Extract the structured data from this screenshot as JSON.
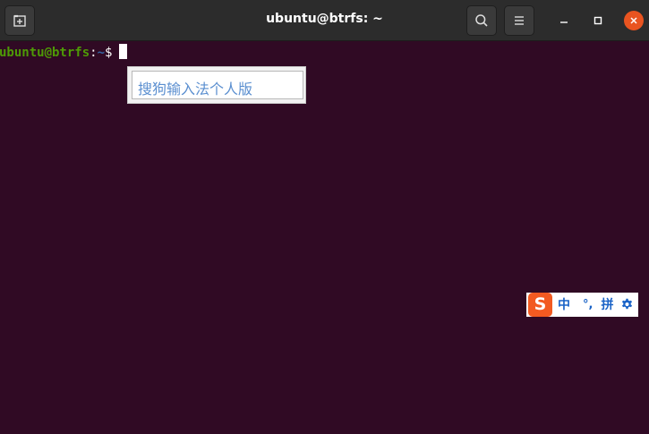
{
  "window": {
    "title": "ubuntu@btrfs: ~",
    "buttons": {
      "new_tab_icon": "new-tab-icon",
      "search_icon": "search-icon",
      "menu_icon": "hamburger-menu-icon",
      "minimize_icon": "minimize-icon",
      "maximize_icon": "maximize-icon",
      "close_icon": "close-icon"
    },
    "colors": {
      "headerbar": "#2c2c2c",
      "background": "#300a24",
      "close": "#e95420"
    }
  },
  "terminal": {
    "prompt": {
      "user_host": "ubuntu@btrfs",
      "colon": ":",
      "path": "~",
      "symbol": "$"
    },
    "colors": {
      "user_host": "#4e9a06",
      "path": "#3465a4",
      "text": "#ffffff"
    }
  },
  "ime": {
    "candidate_text": "搜狗输入法个人版"
  },
  "sogou_bar": {
    "logo": "S",
    "mode": "中",
    "punctuation": "°,",
    "input_method": "拼",
    "settings_icon": "gear-icon",
    "colors": {
      "logo": "#f25a21",
      "text": "#1a63c7"
    }
  }
}
